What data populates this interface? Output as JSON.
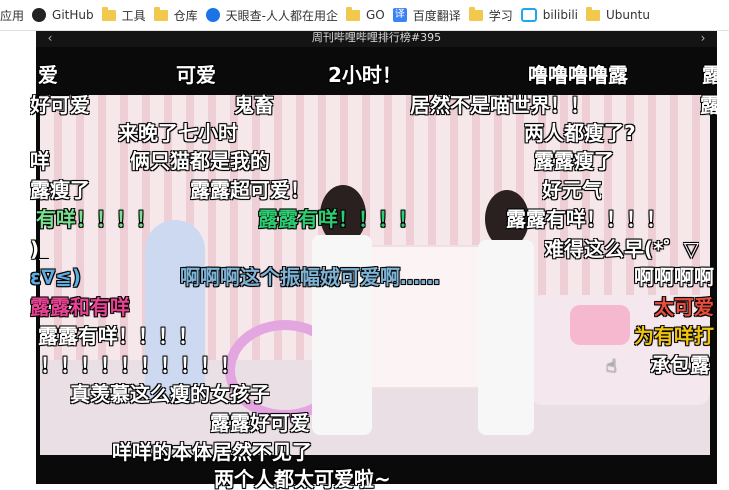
{
  "bookmarks": [
    {
      "label": "应用",
      "icon": "apps-icon"
    },
    {
      "label": "GitHub",
      "icon": "github-icon"
    },
    {
      "label": "工具",
      "icon": "folder-icon"
    },
    {
      "label": "仓库",
      "icon": "folder-icon"
    },
    {
      "label": "天眼查-人人都在用企",
      "icon": "tianyancha-icon"
    },
    {
      "label": "GO",
      "icon": "folder-icon"
    },
    {
      "label": "百度翻译",
      "icon": "translate-icon"
    },
    {
      "label": "学习",
      "icon": "folder-icon"
    },
    {
      "label": "bilibili",
      "icon": "bilibili-icon"
    },
    {
      "label": "Ubuntu",
      "icon": "folder-icon"
    }
  ],
  "player": {
    "title": "周刊哔哩哔哩排行榜#395",
    "prev_icon": "‹",
    "next_icon": "›"
  },
  "danmaku": [
    {
      "text": "爱",
      "color": "#ffffff"
    },
    {
      "text": "可爱",
      "color": "#ffffff"
    },
    {
      "text": "2小时！",
      "color": "#ffffff"
    },
    {
      "text": "噜噜噜噜露",
      "color": "#ffffff"
    },
    {
      "text": "露",
      "color": "#ffffff"
    },
    {
      "text": "好可爱",
      "color": "#ffffff"
    },
    {
      "text": "鬼畜",
      "color": "#ffffff"
    },
    {
      "text": "居然不是喵世界！！",
      "color": "#ffffff"
    },
    {
      "text": "露",
      "color": "#ffffff"
    },
    {
      "text": "来晚了七小时",
      "color": "#ffffff"
    },
    {
      "text": "两人都瘦了?",
      "color": "#ffffff"
    },
    {
      "text": "咩",
      "color": "#ffffff"
    },
    {
      "text": "俩只猫都是我的",
      "color": "#ffffff"
    },
    {
      "text": "露露瘦了",
      "color": "#ffffff"
    },
    {
      "text": "露瘦了",
      "color": "#ffffff"
    },
    {
      "text": "露露超可爱！",
      "color": "#ffffff"
    },
    {
      "text": "好元气",
      "color": "#ffffff"
    },
    {
      "text": "有咩！！！！",
      "color": "#78e08f"
    },
    {
      "text": "露露有咩！！！！",
      "color": "#2ecc71"
    },
    {
      "text": "露露有咩！！！！",
      "color": "#ffffff"
    },
    {
      "text": ")_",
      "color": "#ffffff"
    },
    {
      "text": "难得这么早(*゜▽",
      "color": "#ffffff"
    },
    {
      "text": "ε∇≦)",
      "color": "#5dade2"
    },
    {
      "text": "啊啊啊这个振幅娀可爱啊……",
      "color": "#7fb3d5"
    },
    {
      "text": "啊啊啊啊",
      "color": "#ffffff"
    },
    {
      "text": "露露和有咩",
      "color": "#e84393"
    },
    {
      "text": "太可爱",
      "color": "#e74c3c"
    },
    {
      "text": "露露有咩！！！！",
      "color": "#ffffff"
    },
    {
      "text": "为有咩打",
      "color": "#f1c40f"
    },
    {
      "text": "！！！！！！！！！！",
      "color": "#ffffff"
    },
    {
      "text": "承包露",
      "color": "#ffffff"
    },
    {
      "text": "真羡慕这么瘦的女孩子",
      "color": "#ffffff"
    },
    {
      "text": "露露好可爱",
      "color": "#ffffff"
    },
    {
      "text": "咩咩的本体居然不见了",
      "color": "#ffffff"
    },
    {
      "text": "两个人都太可爱啦~",
      "color": "#ffffff"
    }
  ]
}
